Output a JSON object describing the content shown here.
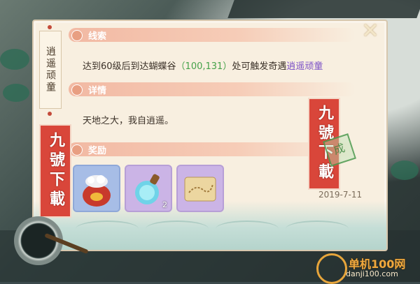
{
  "clue": {
    "npc_tab": "逍遥顽童",
    "sections": {
      "clue_title": "线索",
      "detail_title": "详情",
      "reward_title": "奖励"
    },
    "clue_text_prefix": "达到60级后到达蝴蝶谷",
    "clue_coords": "（100,131）",
    "clue_text_middle": "处可触发奇遇",
    "clue_npc": "逍遥顽童",
    "detail_text": "天地之大，我自逍遥。",
    "rewards": [
      {
        "name": "money-bag-item",
        "count": ""
      },
      {
        "name": "potion-bottle-item",
        "count": "2"
      },
      {
        "name": "treasure-map-item",
        "count": ""
      }
    ],
    "date": "2019-7-11"
  },
  "seal_left": "九號下載",
  "seal_right": "九號下載",
  "stamp_text": "成",
  "close_icon": "close-x-icon",
  "watermark": {
    "name": "单机100网",
    "url": "danji100.com"
  },
  "colors": {
    "coords": "#46a24a",
    "npc": "#7a4fc6",
    "seal": "#d9463a",
    "section_bar": "#f2b9a3"
  }
}
